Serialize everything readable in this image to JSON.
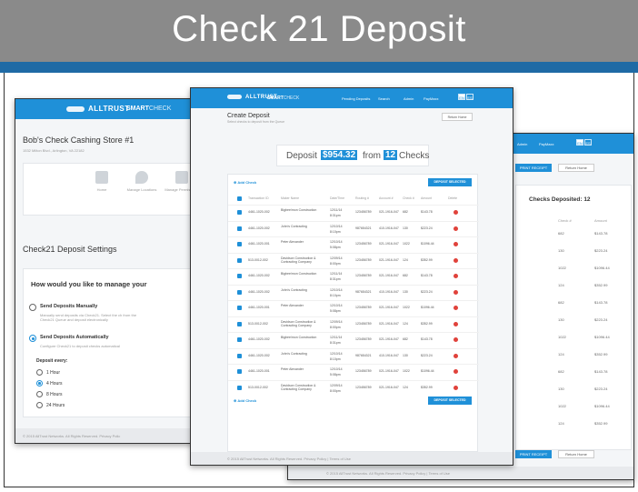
{
  "slide": {
    "title": "Check 21 Deposit"
  },
  "colors": {
    "header_gray": "#8a8a8a",
    "rule_blue": "#1f6aa5",
    "app_blue": "#1f90d8",
    "delete_red": "#e0423b"
  },
  "brand": {
    "logo_text": "ALLTRUST",
    "product_bold": "SMART",
    "product_light": "CHECK"
  },
  "left_window": {
    "store_name": "Bob's Check Cashing Store #1",
    "store_address": "1532 Milton Blvd., Arlington, VA 22182",
    "tiles": [
      {
        "label": "Home",
        "icon": "home-icon"
      },
      {
        "label": "Manage Locations",
        "icon": "location-pin-icon"
      },
      {
        "label": "Manage Permissions",
        "icon": "lock-icon"
      }
    ],
    "settings_title": "Check21 Deposit Settings",
    "question": "How would you like to manage your",
    "option_manual": {
      "label": "Send Deposits Manually",
      "desc": "Manually send deposits via Check21. Select the ch from the Check21 Queue and deposit electronically",
      "selected": false
    },
    "option_auto": {
      "label": "Send Deposits Automatically",
      "desc": "Configure Check21 to deposit checks automatical",
      "selected": true
    },
    "frequency_label": "Deposit every:",
    "frequency_options": [
      {
        "label": "1 Hour",
        "selected": false
      },
      {
        "label": "4 Hours",
        "selected": true
      },
      {
        "label": "8 Hours",
        "selected": false
      },
      {
        "label": "24 Hours",
        "selected": false
      }
    ],
    "footer": "© 2015 AllTrust Networks. All Rights Reserved. Privacy Polic"
  },
  "center_window": {
    "nav": {
      "pending": "Pending Deposits",
      "search": "Search",
      "admin": "Admin",
      "location": "PayMaxx",
      "lang_en": "EN",
      "lang_es": "ES"
    },
    "page_title": "Create Deposit",
    "page_subtitle": "Select checks to deposit from the Queue",
    "return_button": "Return Home",
    "summary": {
      "prefix": "Deposit",
      "amount": "$954.32",
      "middle": "from",
      "count": "12",
      "suffix": "Checks"
    },
    "add_check": "Add Check",
    "deposit_selected": "DEPOSIT SELECTED",
    "columns": [
      "Transaction ID",
      "Maker Name",
      "Date/Time",
      "Routing #",
      "Account #",
      "Check #",
      "Amount",
      "Delete"
    ],
    "rows": [
      {
        "tid": "4461-1020-002",
        "maker": "Bigbee/mon Construction",
        "date": "12/11/14",
        "time": "8:31pm",
        "routing": "123456789",
        "account": "021-1916-047",
        "check": "682",
        "amount": "$143.78"
      },
      {
        "tid": "4461-1020-002",
        "maker": "John's Contracting",
        "date": "12/10/14",
        "time": "8:10pm",
        "routing": "987654321",
        "account": "410-1916-047",
        "check": "130",
        "amount": "$223.24"
      },
      {
        "tid": "4461-1020-001",
        "maker": "Peter Alexander",
        "date": "12/10/14",
        "time": "5:08pm",
        "routing": "123456789",
        "account": "021-1916-047",
        "check": "1022",
        "amount": "$1096.44"
      },
      {
        "tid": "513-0012-002",
        "maker": "Davidson Construction & Contracting Company",
        "date": "12/09/14",
        "time": "8:00pm",
        "routing": "123456789",
        "account": "021-1916-047",
        "check": "124",
        "amount": "$352.99"
      },
      {
        "tid": "4461-1020-002",
        "maker": "Bigbee/mon Construction",
        "date": "12/11/14",
        "time": "8:31pm",
        "routing": "123456789",
        "account": "021-1916-047",
        "check": "682",
        "amount": "$143.78"
      },
      {
        "tid": "4461-1020-002",
        "maker": "John's Contracting",
        "date": "12/10/14",
        "time": "8:10pm",
        "routing": "987654321",
        "account": "410-1916-047",
        "check": "130",
        "amount": "$223.24"
      },
      {
        "tid": "4461-1020-001",
        "maker": "Peter Alexander",
        "date": "12/10/14",
        "time": "5:08pm",
        "routing": "123456789",
        "account": "021-1916-047",
        "check": "1022",
        "amount": "$1096.44"
      },
      {
        "tid": "513-0012-002",
        "maker": "Davidson Construction & Contracting Company",
        "date": "12/09/14",
        "time": "8:00pm",
        "routing": "123456789",
        "account": "021-1916-047",
        "check": "124",
        "amount": "$352.99"
      },
      {
        "tid": "4461-1020-002",
        "maker": "Bigbee/mon Construction",
        "date": "12/11/14",
        "time": "8:31pm",
        "routing": "123456789",
        "account": "021-1916-047",
        "check": "682",
        "amount": "$143.78"
      },
      {
        "tid": "4461-1020-002",
        "maker": "John's Contracting",
        "date": "12/10/14",
        "time": "8:10pm",
        "routing": "987654321",
        "account": "410-1916-047",
        "check": "130",
        "amount": "$223.24"
      },
      {
        "tid": "4461-1020-001",
        "maker": "Peter Alexander",
        "date": "12/10/14",
        "time": "5:08pm",
        "routing": "123456789",
        "account": "021-1916-047",
        "check": "1022",
        "amount": "$1096.44"
      },
      {
        "tid": "513-0012-002",
        "maker": "Davidson Construction & Contracting Company",
        "date": "12/09/14",
        "time": "8:00pm",
        "routing": "123456789",
        "account": "021-1916-047",
        "check": "124",
        "amount": "$352.99"
      }
    ],
    "footer": "© 2015 AllTrust Networks. All Rights Reserved. Privacy Policy | Terms of Use"
  },
  "right_window": {
    "nav": {
      "admin": "Admin",
      "location": "PayMaxx",
      "lang_en": "EN",
      "lang_es": "ES"
    },
    "print_button": "PRINT RECEIPT",
    "return_button": "Return Home",
    "checks_deposited": "Checks Deposited: 12",
    "columns": [
      "Check #",
      "Amount"
    ],
    "rows": [
      {
        "check": "682",
        "amount": "$143.78"
      },
      {
        "check": "130",
        "amount": "$223.24"
      },
      {
        "check": "1022",
        "amount": "$1096.44"
      },
      {
        "check": "124",
        "amount": "$352.99"
      },
      {
        "check": "682",
        "amount": "$143.78"
      },
      {
        "check": "130",
        "amount": "$223.24"
      },
      {
        "check": "1022",
        "amount": "$1096.44"
      },
      {
        "check": "124",
        "amount": "$352.99"
      },
      {
        "check": "682",
        "amount": "$143.78"
      },
      {
        "check": "130",
        "amount": "$223.24"
      },
      {
        "check": "1022",
        "amount": "$1096.44"
      },
      {
        "check": "124",
        "amount": "$352.99"
      }
    ],
    "footer": "© 2015 AllTrust Networks. All Rights Reserved. Privacy Policy | Terms of Use"
  }
}
